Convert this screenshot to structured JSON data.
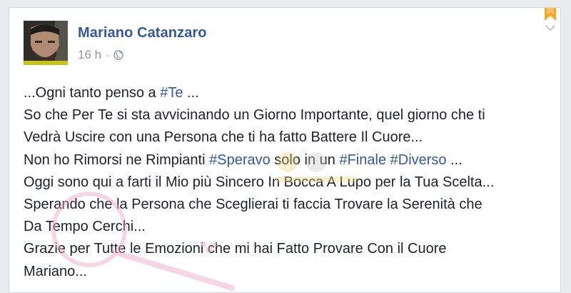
{
  "post": {
    "author": "Mariano Catanzaro",
    "time": "16 h",
    "separator": "·",
    "icons": {
      "avatar": "avatar",
      "privacy": "globe-icon",
      "bookmark": "bookmark-icon",
      "menu": "chevron-down-icon"
    },
    "lines": [
      {
        "t1": "...Ogni tanto penso a ",
        "tag": "#Te",
        "t2": " ..."
      },
      {
        "t": "So che Per Te si sta avvicinando un Giorno Importante, quel giorno che ti"
      },
      {
        "t": "Vedrà Uscire con una Persona che ti ha fatto Battere Il Cuore..."
      },
      {
        "t1": "Non ho Rimorsi ne Rimpianti ",
        "tag1": "#Speravo",
        "t2": " solo in un ",
        "tag2": "#Finale",
        "t3": " ",
        "tag3": "#Diverso",
        "t4": " ..."
      },
      {
        "t": "Oggi sono qui a farti il Mio più Sincero In Bocca A Lupo per la Tua Scelta..."
      },
      {
        "t": "Sperando che la Persona che Sceglierai ti faccia Trovare la Serenità che"
      },
      {
        "t": "Da Tempo Cerchi..."
      },
      {
        "t": "Grazie per Tutte le Emozioni che mi hai Fatto Provare Con il Cuore"
      },
      {
        "t": "Mariano..."
      }
    ]
  },
  "colors": {
    "link": "#365899",
    "text": "#1d2129",
    "muted": "#90949c",
    "bookmark": "#f5a623",
    "watermark": "#e8a6c4"
  }
}
